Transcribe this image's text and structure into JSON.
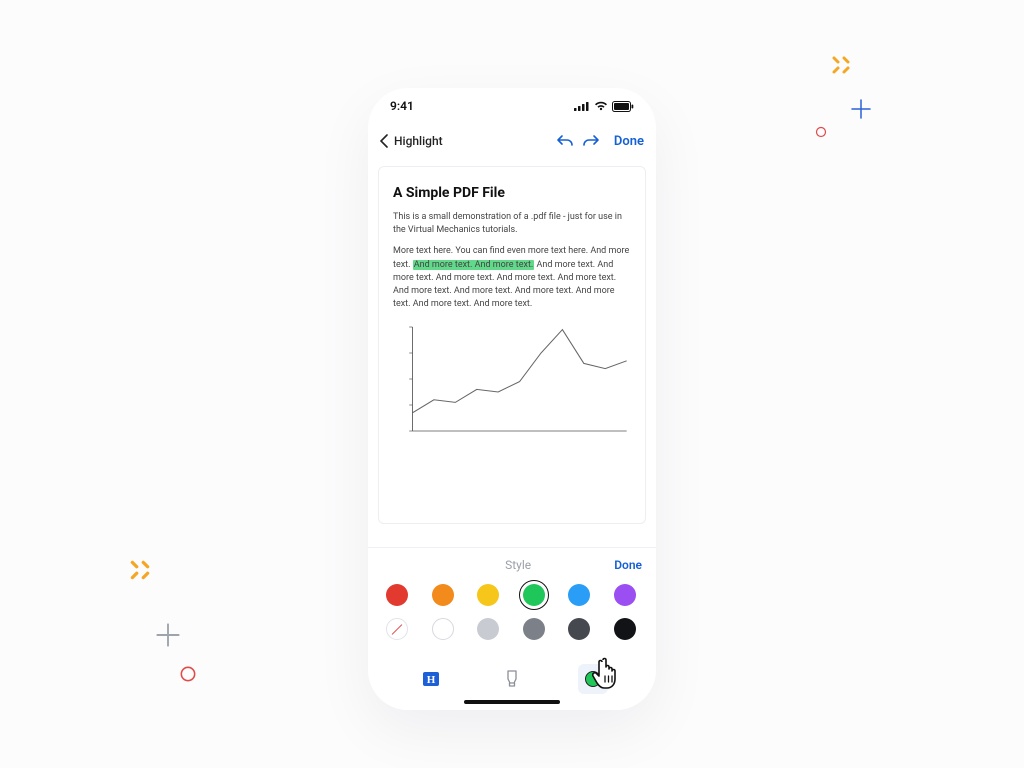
{
  "status": {
    "time": "9:41"
  },
  "nav": {
    "title": "Highlight",
    "done_label": "Done"
  },
  "document": {
    "title": "A Simple PDF File",
    "p1": "This is a small demonstration of a .pdf file - just for use in the Virtual Mechanics tutorials.",
    "p2_pre": "More text here. You can find even more text here. And more text. ",
    "p2_highlight": "And more text. And more text.",
    "p2_post": " And more text. And more text. And more text. And more text. And more text. And more text. And more text. And more text. And more text. And more text. And more text."
  },
  "styleSheet": {
    "title": "Style",
    "done_label": "Done",
    "colors_row1": [
      {
        "name": "red",
        "hex": "#e23a2e",
        "selected": false
      },
      {
        "name": "orange",
        "hex": "#f28a1c",
        "selected": false
      },
      {
        "name": "yellow",
        "hex": "#f6c61a",
        "selected": false
      },
      {
        "name": "green",
        "hex": "#1fc659",
        "selected": true
      },
      {
        "name": "blue",
        "hex": "#2a9df7",
        "selected": false
      },
      {
        "name": "purple",
        "hex": "#9b4ef1",
        "selected": false
      }
    ],
    "colors_row2": [
      {
        "name": "none",
        "kind": "none"
      },
      {
        "name": "white",
        "kind": "hollow"
      },
      {
        "name": "lightgray",
        "hex": "#c8ccd2"
      },
      {
        "name": "gray",
        "hex": "#7c8089"
      },
      {
        "name": "darkgray",
        "hex": "#45484f"
      },
      {
        "name": "black",
        "hex": "#111316"
      }
    ]
  },
  "bottomTools": {
    "active_chip_color": "#1fc659"
  },
  "chart_data": {
    "type": "line",
    "x": [
      0,
      1,
      2,
      3,
      4,
      5,
      6,
      7,
      8,
      9,
      10
    ],
    "y": [
      14,
      24,
      22,
      32,
      30,
      38,
      60,
      78,
      52,
      48,
      54
    ],
    "ylim": [
      0,
      80
    ],
    "xlim": [
      0,
      10
    ],
    "title": "",
    "xlabel": "",
    "ylabel": ""
  }
}
